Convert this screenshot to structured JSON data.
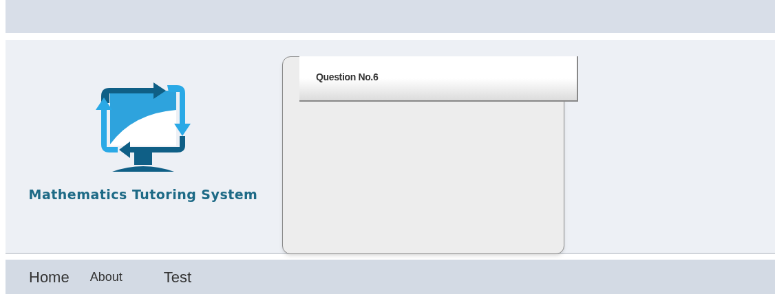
{
  "logo": {
    "title": "Mathematics Tutoring System"
  },
  "question": {
    "title": "Question No.6"
  },
  "nav": [
    {
      "label": "Home"
    },
    {
      "label": "About"
    },
    {
      "label": "Test"
    }
  ]
}
